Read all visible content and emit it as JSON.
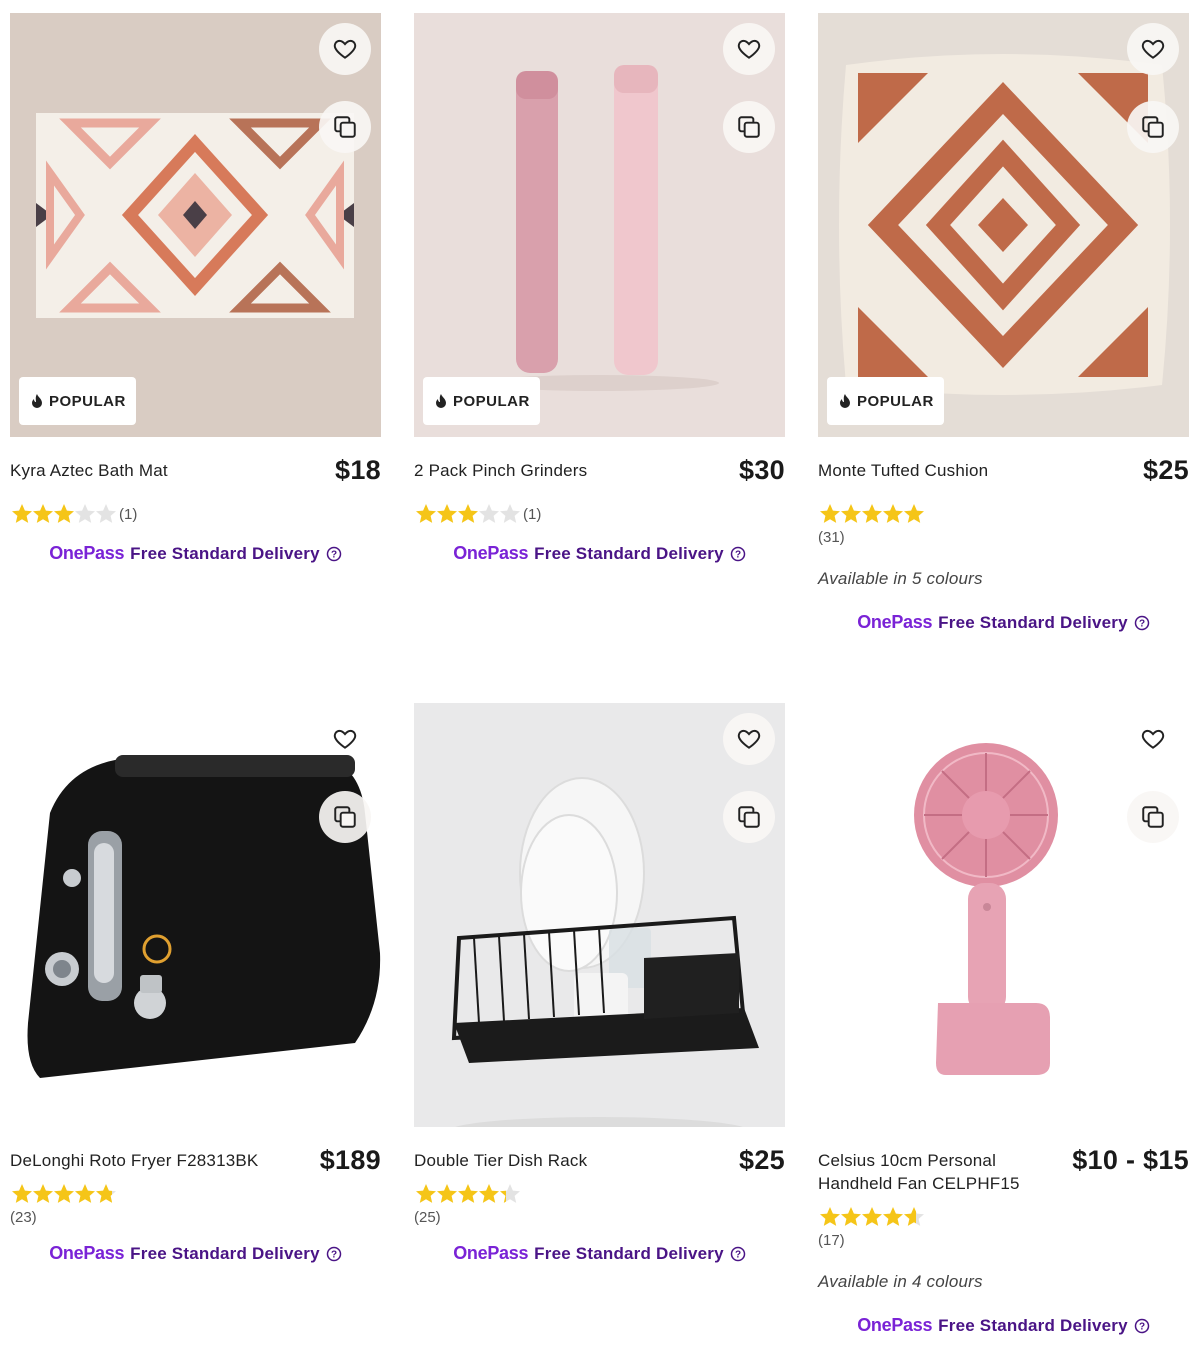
{
  "products": [
    {
      "title": "Kyra Aztec Bath Mat",
      "price": "$18",
      "rating": 3,
      "count": "(1)",
      "badge": "POPULAR",
      "colours": null
    },
    {
      "title": "2 Pack Pinch Grinders",
      "price": "$30",
      "rating": 3,
      "count": "(1)",
      "badge": "POPULAR",
      "colours": null
    },
    {
      "title": "Monte Tufted Cushion",
      "price": "$25",
      "rating": 5,
      "count": "(31)",
      "badge": "POPULAR",
      "colours": "Available in 5 colours"
    },
    {
      "title": "DeLonghi Roto Fryer F28313BK",
      "price": "$189",
      "rating": 4.8,
      "count": "(23)",
      "badge": null,
      "colours": null
    },
    {
      "title": "Double Tier Dish Rack",
      "price": "$25",
      "rating": 4.3,
      "count": "(25)",
      "badge": null,
      "colours": null
    },
    {
      "title": "Celsius 10cm Personal Handheld Fan CELPHF15",
      "price": "$10 - $15",
      "rating": 4.6,
      "count": "(17)",
      "badge": null,
      "colours": "Available in 4 colours"
    }
  ],
  "delivery": {
    "logo": "OnePass",
    "text": "Free Standard Delivery"
  },
  "colors": {
    "star": "#f5c518",
    "star_empty": "#e3e3e3",
    "onepass": "#7a23d6",
    "delivery": "#4a1486"
  },
  "icons": {
    "favourite": "heart-icon",
    "compare": "compare-icon",
    "popular": "flame-icon",
    "help": "help-circle-icon"
  }
}
